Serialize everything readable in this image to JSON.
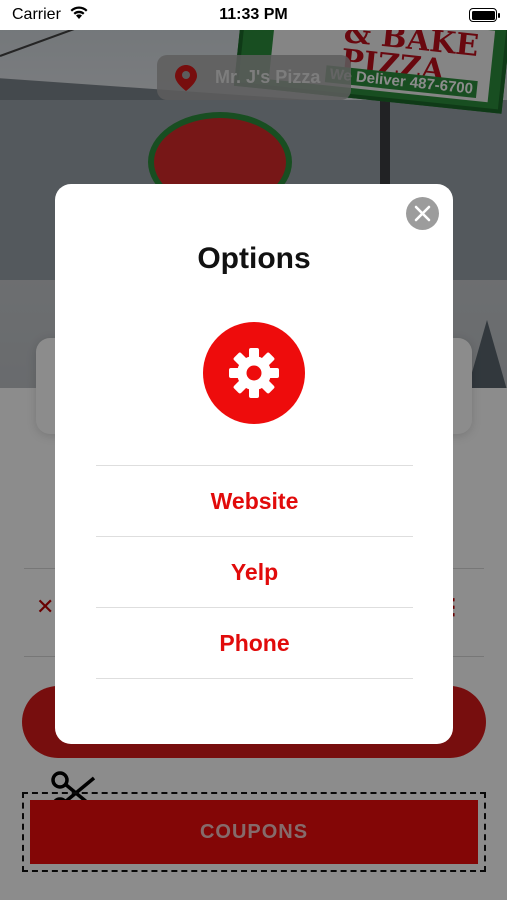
{
  "status_bar": {
    "carrier": "Carrier",
    "time": "11:33 PM"
  },
  "location": {
    "name": "Mr. J's Pizza"
  },
  "hero_sign": {
    "line1": "& BAKE",
    "line2": "PIZZA",
    "phone": "We Deliver 487-6700"
  },
  "page": {
    "coupons_label": "COUPONS"
  },
  "modal": {
    "title": "Options",
    "options": [
      {
        "label": "Website"
      },
      {
        "label": "Yelp"
      },
      {
        "label": "Phone"
      }
    ]
  },
  "colors": {
    "accent_red": "#ee0c0c",
    "option_text_red": "#e10b0b",
    "close_gray": "#9c9c9c"
  }
}
